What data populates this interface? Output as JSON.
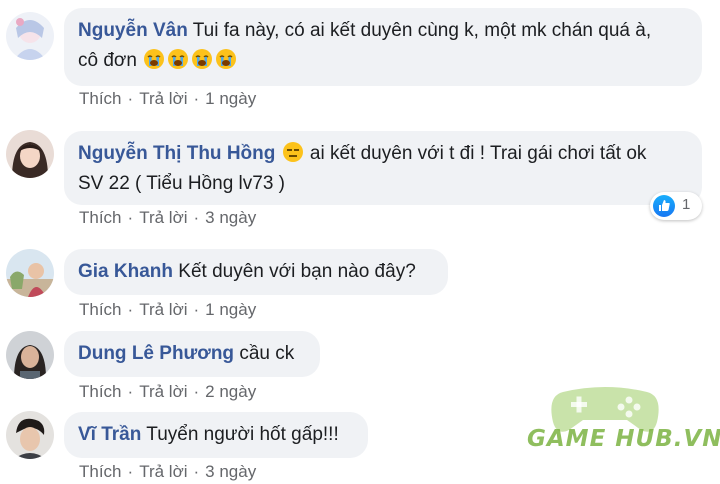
{
  "comments": [
    {
      "author": "Nguyễn Vân",
      "text_line1": "Tui fa này, có ai kết duyên cùng k, một mk chán quá à,",
      "text_line2": "cô đơn",
      "emojis": [
        "crying-emoji",
        "crying-emoji",
        "crying-emoji",
        "crying-emoji"
      ],
      "like_label": "Thích",
      "reply_label": "Trả lời",
      "time": "1 ngày"
    },
    {
      "author": "Nguyễn Thị Thu Hồng",
      "text_line1": "ai kết duyên với t đi ! Trai gái chơi tất ok",
      "text_line2": "SV 22 ( Tiểu Hồng lv73 )",
      "like_label": "Thích",
      "reply_label": "Trả lời",
      "time": "3 ngày",
      "reaction_count": "1"
    },
    {
      "author": "Gia Khanh",
      "text_line1": "Kết duyên với bạn nào đây?",
      "like_label": "Thích",
      "reply_label": "Trả lời",
      "time": "1 ngày"
    },
    {
      "author": "Dung Lê Phương",
      "text_line1": "cầu ck",
      "like_label": "Thích",
      "reply_label": "Trả lời",
      "time": "2 ngày"
    },
    {
      "author": "Vĩ Trần",
      "text_line1": "Tuyển người hốt gấp!!!",
      "like_label": "Thích",
      "reply_label": "Trả lời",
      "time": "3 ngày"
    }
  ],
  "separator": "·",
  "watermark": {
    "text": "GAME HUB.VN"
  },
  "colors": {
    "author": "#385898",
    "bubble": "#f0f2f5",
    "meta": "#65676b",
    "like": "#1877f2"
  }
}
